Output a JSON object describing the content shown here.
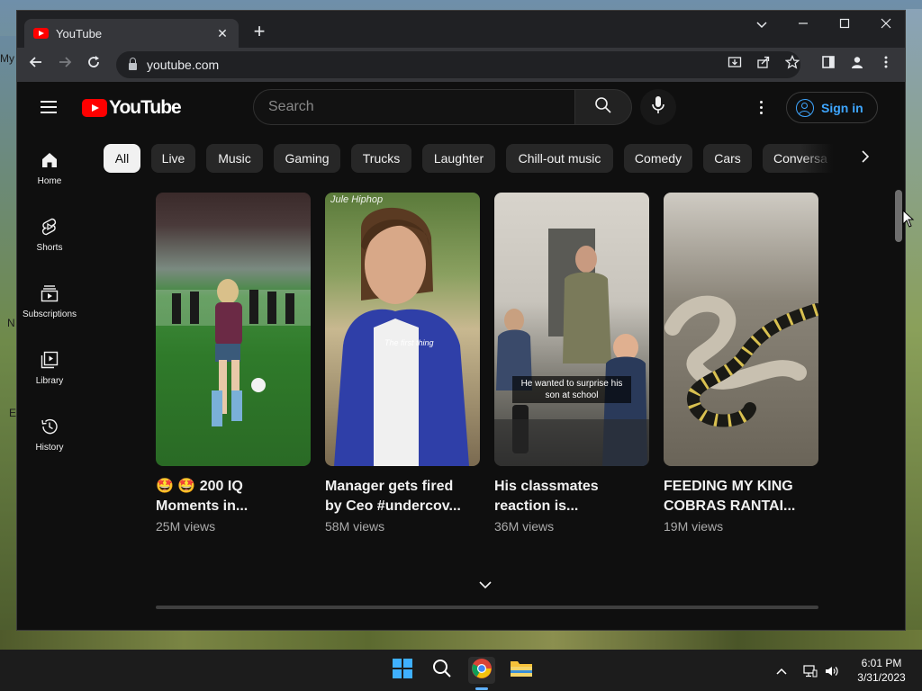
{
  "desktop": {
    "icon_labels": [
      "My",
      "N",
      "E"
    ]
  },
  "browser": {
    "tab": {
      "title": "YouTube"
    },
    "url": "youtube.com"
  },
  "youtube": {
    "logo_text": "YouTube",
    "search": {
      "placeholder": "Search"
    },
    "sign_in_label": "Sign in",
    "guide": [
      {
        "label": "Home",
        "icon": "home-icon"
      },
      {
        "label": "Shorts",
        "icon": "shorts-icon"
      },
      {
        "label": "Subscriptions",
        "icon": "subscriptions-icon"
      },
      {
        "label": "Library",
        "icon": "library-icon"
      },
      {
        "label": "History",
        "icon": "history-icon"
      }
    ],
    "chips": [
      "All",
      "Live",
      "Music",
      "Gaming",
      "Trucks",
      "Laughter",
      "Chill-out music",
      "Comedy",
      "Cars",
      "Conversa"
    ],
    "shorts": [
      {
        "title_line1": "🤩 🤩 200 IQ",
        "title_line2": "Moments in...",
        "views": "25M views",
        "overlay": ""
      },
      {
        "title_line1": "Manager gets fired",
        "title_line2": "by Ceo #undercov...",
        "views": "58M views",
        "overlay": "",
        "watermark": "Jule Hiphop",
        "script": "The first thing"
      },
      {
        "title_line1": "His classmates",
        "title_line2": "reaction is...",
        "views": "36M views",
        "overlay": "He wanted to surprise his son at school"
      },
      {
        "title_line1": "FEEDING MY KING",
        "title_line2": "COBRAS RANTAI...",
        "views": "19M views",
        "overlay": ""
      }
    ]
  },
  "taskbar": {
    "time": "6:01 PM",
    "date": "3/31/2023"
  },
  "colors": {
    "youtube_red": "#ff0000",
    "page_bg": "#0f0f0f",
    "chip_bg": "#272727",
    "link_blue": "#3ea6ff"
  }
}
